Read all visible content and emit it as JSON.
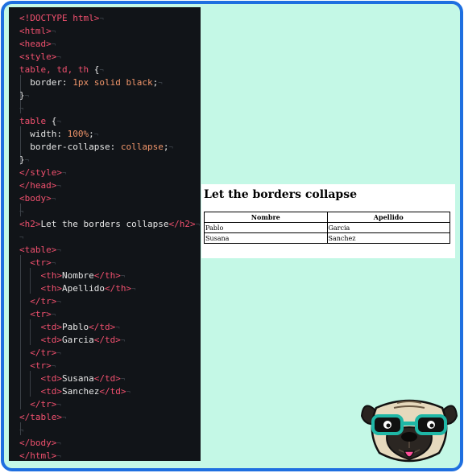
{
  "code": {
    "lines": [
      {
        "parts": [
          {
            "t": "tag",
            "v": "<!DOCTYPE html>"
          }
        ]
      },
      {
        "parts": [
          {
            "t": "tag",
            "v": "<html>"
          }
        ]
      },
      {
        "parts": [
          {
            "t": "tag",
            "v": "<head>"
          }
        ]
      },
      {
        "parts": [
          {
            "t": "tag",
            "v": "<style>"
          }
        ]
      },
      {
        "parts": [
          {
            "t": "tag",
            "v": "table, td, th "
          },
          {
            "t": "sym",
            "v": "{"
          }
        ]
      },
      {
        "parts": [
          {
            "t": "prop",
            "v": "  border: "
          },
          {
            "t": "val",
            "v": "1px solid black"
          },
          {
            "t": "sym",
            "v": ";"
          }
        ]
      },
      {
        "parts": [
          {
            "t": "sym",
            "v": "}"
          }
        ]
      },
      {
        "parts": []
      },
      {
        "parts": [
          {
            "t": "tag",
            "v": "table "
          },
          {
            "t": "sym",
            "v": "{"
          }
        ]
      },
      {
        "parts": [
          {
            "t": "prop",
            "v": "  width: "
          },
          {
            "t": "val",
            "v": "100%"
          },
          {
            "t": "sym",
            "v": ";"
          }
        ]
      },
      {
        "parts": [
          {
            "t": "prop",
            "v": "  border-collapse: "
          },
          {
            "t": "val",
            "v": "collapse"
          },
          {
            "t": "sym",
            "v": ";"
          }
        ]
      },
      {
        "parts": [
          {
            "t": "sym",
            "v": "}"
          }
        ]
      },
      {
        "parts": [
          {
            "t": "tag",
            "v": "</style>"
          }
        ]
      },
      {
        "parts": [
          {
            "t": "tag",
            "v": "</head>"
          }
        ]
      },
      {
        "parts": [
          {
            "t": "tag",
            "v": "<body>"
          }
        ]
      },
      {
        "parts": []
      },
      {
        "parts": [
          {
            "t": "tag",
            "v": "<h2>"
          },
          {
            "t": "text",
            "v": "Let the borders collapse"
          },
          {
            "t": "tag",
            "v": "</h2>"
          }
        ]
      },
      {
        "parts": []
      },
      {
        "parts": [
          {
            "t": "tag",
            "v": "<table>"
          }
        ]
      },
      {
        "parts": [
          {
            "t": "tag",
            "v": "  <tr>"
          }
        ]
      },
      {
        "parts": [
          {
            "t": "tag",
            "v": "    <th>"
          },
          {
            "t": "text",
            "v": "Nombre"
          },
          {
            "t": "tag",
            "v": "</th>"
          }
        ]
      },
      {
        "parts": [
          {
            "t": "tag",
            "v": "    <th>"
          },
          {
            "t": "text",
            "v": "Apellido"
          },
          {
            "t": "tag",
            "v": "</th>"
          }
        ]
      },
      {
        "parts": [
          {
            "t": "tag",
            "v": "  </tr>"
          }
        ]
      },
      {
        "parts": [
          {
            "t": "tag",
            "v": "  <tr>"
          }
        ]
      },
      {
        "parts": [
          {
            "t": "tag",
            "v": "    <td>"
          },
          {
            "t": "text",
            "v": "Pablo"
          },
          {
            "t": "tag",
            "v": "</td>"
          }
        ]
      },
      {
        "parts": [
          {
            "t": "tag",
            "v": "    <td>"
          },
          {
            "t": "text",
            "v": "Garcia"
          },
          {
            "t": "tag",
            "v": "</td>"
          }
        ]
      },
      {
        "parts": [
          {
            "t": "tag",
            "v": "  </tr>"
          }
        ]
      },
      {
        "parts": [
          {
            "t": "tag",
            "v": "  <tr>"
          }
        ]
      },
      {
        "parts": [
          {
            "t": "tag",
            "v": "    <td>"
          },
          {
            "t": "text",
            "v": "Susana"
          },
          {
            "t": "tag",
            "v": "</td>"
          }
        ]
      },
      {
        "parts": [
          {
            "t": "tag",
            "v": "    <td>"
          },
          {
            "t": "text",
            "v": "Sanchez"
          },
          {
            "t": "tag",
            "v": "</td>"
          }
        ]
      },
      {
        "parts": [
          {
            "t": "tag",
            "v": "  </tr>"
          }
        ]
      },
      {
        "parts": [
          {
            "t": "tag",
            "v": "</table>"
          }
        ]
      },
      {
        "parts": []
      },
      {
        "parts": [
          {
            "t": "tag",
            "v": "</body>"
          }
        ]
      },
      {
        "parts": [
          {
            "t": "tag",
            "v": "</html>"
          }
        ]
      }
    ]
  },
  "preview": {
    "heading": "Let the borders collapse",
    "headers": [
      "Nombre",
      "Apellido"
    ],
    "rows": [
      [
        "Pablo",
        "Garcia"
      ],
      [
        "Susana",
        "Sanchez"
      ]
    ]
  },
  "colors": {
    "frame_border": "#1e6fe0",
    "background": "#c4f8e6",
    "editor_bg": "#111418",
    "tag": "#f0506e",
    "value": "#f0956a"
  },
  "icons": {
    "mascot": "pug-with-glasses-icon"
  }
}
